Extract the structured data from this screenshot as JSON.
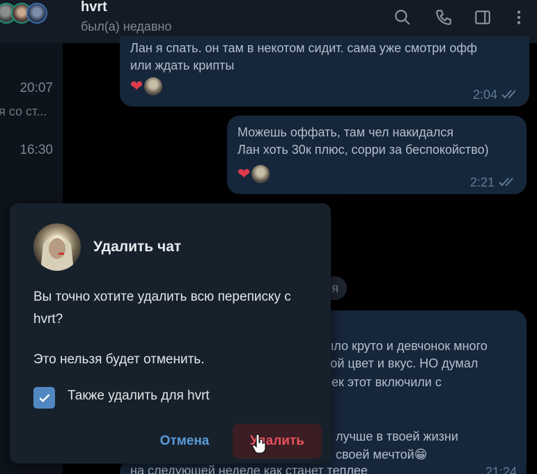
{
  "sidebar": {
    "time1": "20:07",
    "preview": "я со ст...",
    "time2": "16:30"
  },
  "header": {
    "name": "hvrt",
    "status": "был(а) недавно",
    "icons": [
      "search-icon",
      "phone-icon",
      "sidebar-toggle-icon",
      "more-vertical-icon"
    ]
  },
  "messages": [
    {
      "lines": "Лан я спать. он там в некотом сидит. сама уже смотри офф\nили ждать крипты",
      "time": "2:04",
      "reaction": "heart"
    },
    {
      "lines": "Можешь оффать, там чел накидался\nЛан хоть 30к плюс, сорри за беспокойство)",
      "time": "2:21",
      "reaction": "heart"
    }
  ],
  "date_pill": "я",
  "background_message": {
    "line1": "было круто и девчонок много",
    "line2": "бой цвет и вкус. НО думал",
    "line3": "рек этот включили с",
    "line4": "лучше в твоей жизни",
    "line5": "своей мечтой😁",
    "line6": "на следующей неделе как станет теплее",
    "time": "21:24"
  },
  "dialog": {
    "title": "Удалить чат",
    "body": "Вы точно хотите удалить всю переписку с hvrt?",
    "warning": "Это нельзя будет отменить.",
    "checkbox_label": "Также удалить для hvrt",
    "checkbox_checked": true,
    "cancel": "Отмена",
    "delete": "Удалить"
  },
  "colors": {
    "accent": "#5288c1",
    "danger": "#e8505b",
    "bubble": "#16273b"
  }
}
